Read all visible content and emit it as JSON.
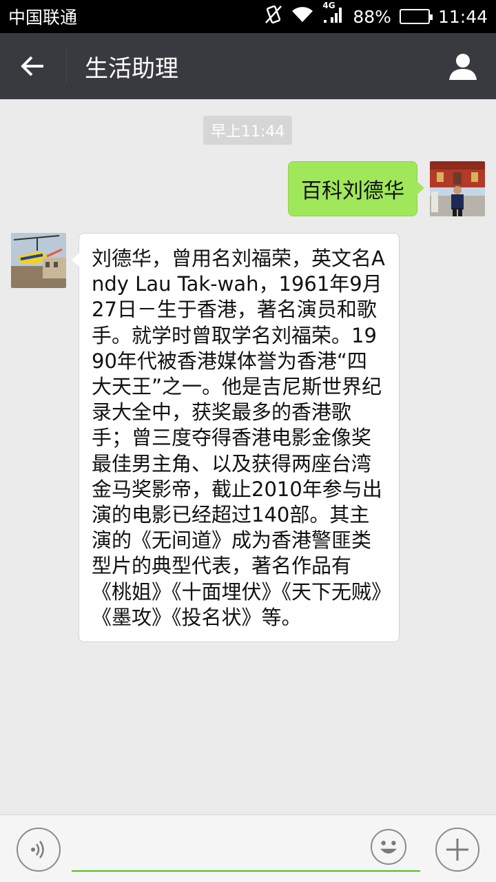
{
  "status_bar": {
    "carrier": "中国联通",
    "network": "4G",
    "battery": "88%",
    "battery_level": 0.88,
    "time": "11:44"
  },
  "header": {
    "title": "生活助理"
  },
  "chat": {
    "timestamp": "早上11:44",
    "outgoing_message": "百科刘德华",
    "incoming_message": "刘德华，曾用名刘福荣，英文名Andy Lau Tak-wah，1961年9月27日－生于香港，著名演员和歌手。就学时曾取学名刘福荣。1990年代被香港媒体誉为香港“四大天王”之一。他是吉尼斯世界纪录大全中，获奖最多的香港歌手；曾三度夺得香港电影金像奖最佳男主角、以及获得两座台湾金马奖影帝，截止2010年参与出演的电影已经超过140部。其主演的《无间道》成为香港警匪类型片的典型代表，著名作品有《桃姐》《十面埋伏》《天下无贼》《墨攻》《投名状》等。"
  },
  "input_bar": {
    "value": "",
    "icons": [
      "voice-icon",
      "emoji-icon",
      "plus-icon"
    ]
  },
  "colors": {
    "header_bg": "#393a3f",
    "outgoing_bubble": "#a0e75a",
    "input_underline": "#45c01a",
    "chat_bg": "#ebebeb"
  }
}
